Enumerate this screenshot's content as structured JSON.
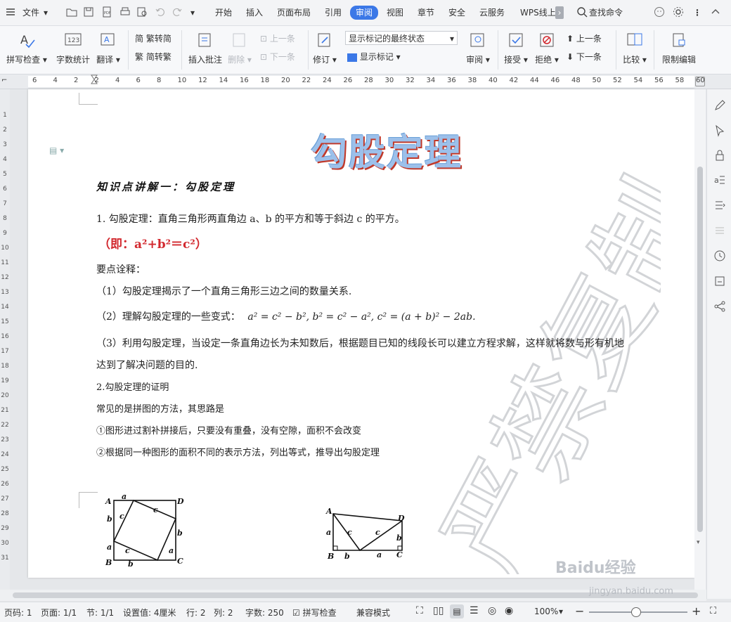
{
  "menubar": {
    "file": "文件",
    "tabs": [
      "开始",
      "插入",
      "页面布局",
      "引用",
      "审阅",
      "视图",
      "章节",
      "安全",
      "云服务",
      "WPS线上"
    ],
    "active_tab": "审阅",
    "search": "查找命令"
  },
  "ribbon": {
    "spellcheck": "拼写检查",
    "wordcount": "字数统计",
    "translate": "翻译",
    "to_traditional": "繁转简",
    "to_simplified": "简转繁",
    "insert_comment": "插入批注",
    "delete": "删除",
    "prev": "上一条",
    "next": "下一条",
    "revise": "修订",
    "markup_select": "显示标记的最终状态",
    "show_markup": "显示标记",
    "review": "审阅",
    "accept": "接受",
    "reject": "拒绝",
    "prev2": "上一条",
    "next2": "下一条",
    "compare": "比较",
    "restrict": "限制编辑"
  },
  "ruler": {
    "h_ticks": [
      "6",
      "4",
      "2",
      "2",
      "4",
      "6",
      "8",
      "10",
      "12",
      "14",
      "16",
      "18",
      "20",
      "22",
      "24",
      "26",
      "28",
      "30",
      "32",
      "34",
      "36",
      "38",
      "40",
      "42",
      "44",
      "46",
      "48",
      "50",
      "52",
      "54",
      "56",
      "58",
      "60"
    ],
    "v_ticks": [
      "1",
      "2",
      "3",
      "4",
      "5",
      "6",
      "7",
      "8",
      "9",
      "10",
      "11",
      "12",
      "13",
      "14",
      "15",
      "16",
      "17",
      "18",
      "19",
      "20",
      "21",
      "22",
      "23",
      "24",
      "25",
      "26",
      "27",
      "28",
      "29",
      "30",
      "31"
    ]
  },
  "document": {
    "title": "勾股定理",
    "heading": "知识点讲解一：勾股定理",
    "p1": "1. 勾股定理：直角三角形两直角边 a、b 的平方和等于斜边 c 的平方。",
    "formula": "（即：a²+b²＝c²）",
    "p2": "要点诠释：",
    "p3": "（1）勾股定理揭示了一个直角三角形三边之间的数量关系.",
    "p4": "（2）理解勾股定理的一些变式：",
    "p4_formula": "a² = c² − b²,   b² = c² − a²,    c² = (a + b)² − 2ab.",
    "p5": "（3）利用勾股定理，当设定一条直角边长为未知数后，根据题目已知的线段长可以建立方程求解，这样就将数与形有机地",
    "p6": "达到了解决问题的目的.",
    "p7": "2.勾股定理的证明",
    "p8": "常见的是拼图的方法，其思路是",
    "p9": "①图形进过割补拼接后，只要没有重叠，没有空隙，面积不会改变",
    "p10": "②根据同一种图形的面积不同的表示方法，列出等式，推导出勾股定理",
    "fig1_labels": [
      "A",
      "a",
      "D",
      "b",
      "c",
      "c",
      "b",
      "a",
      "c",
      "a",
      "B",
      "b",
      "C"
    ],
    "fig2_labels": [
      "A",
      "D",
      "a",
      "c",
      "c",
      "b",
      "B",
      "b",
      "a",
      "C"
    ],
    "watermark": "严禁复制"
  },
  "status": {
    "page_num": "页码: 1",
    "pages": "页面: 1/1",
    "section": "节: 1/1",
    "setting": "设置值: 4厘米",
    "row": "行: 2",
    "col": "列: 2",
    "words": "字数: 250",
    "spell": "拼写检查",
    "compat": "兼容模式",
    "zoom": "100%"
  },
  "brand": {
    "baidu": "Baidu经验",
    "url": "jingyan.baidu.com"
  },
  "colors": {
    "accent": "#3b78e7",
    "formula_red": "#d2282e",
    "title_fill": "#9cc0ea"
  }
}
